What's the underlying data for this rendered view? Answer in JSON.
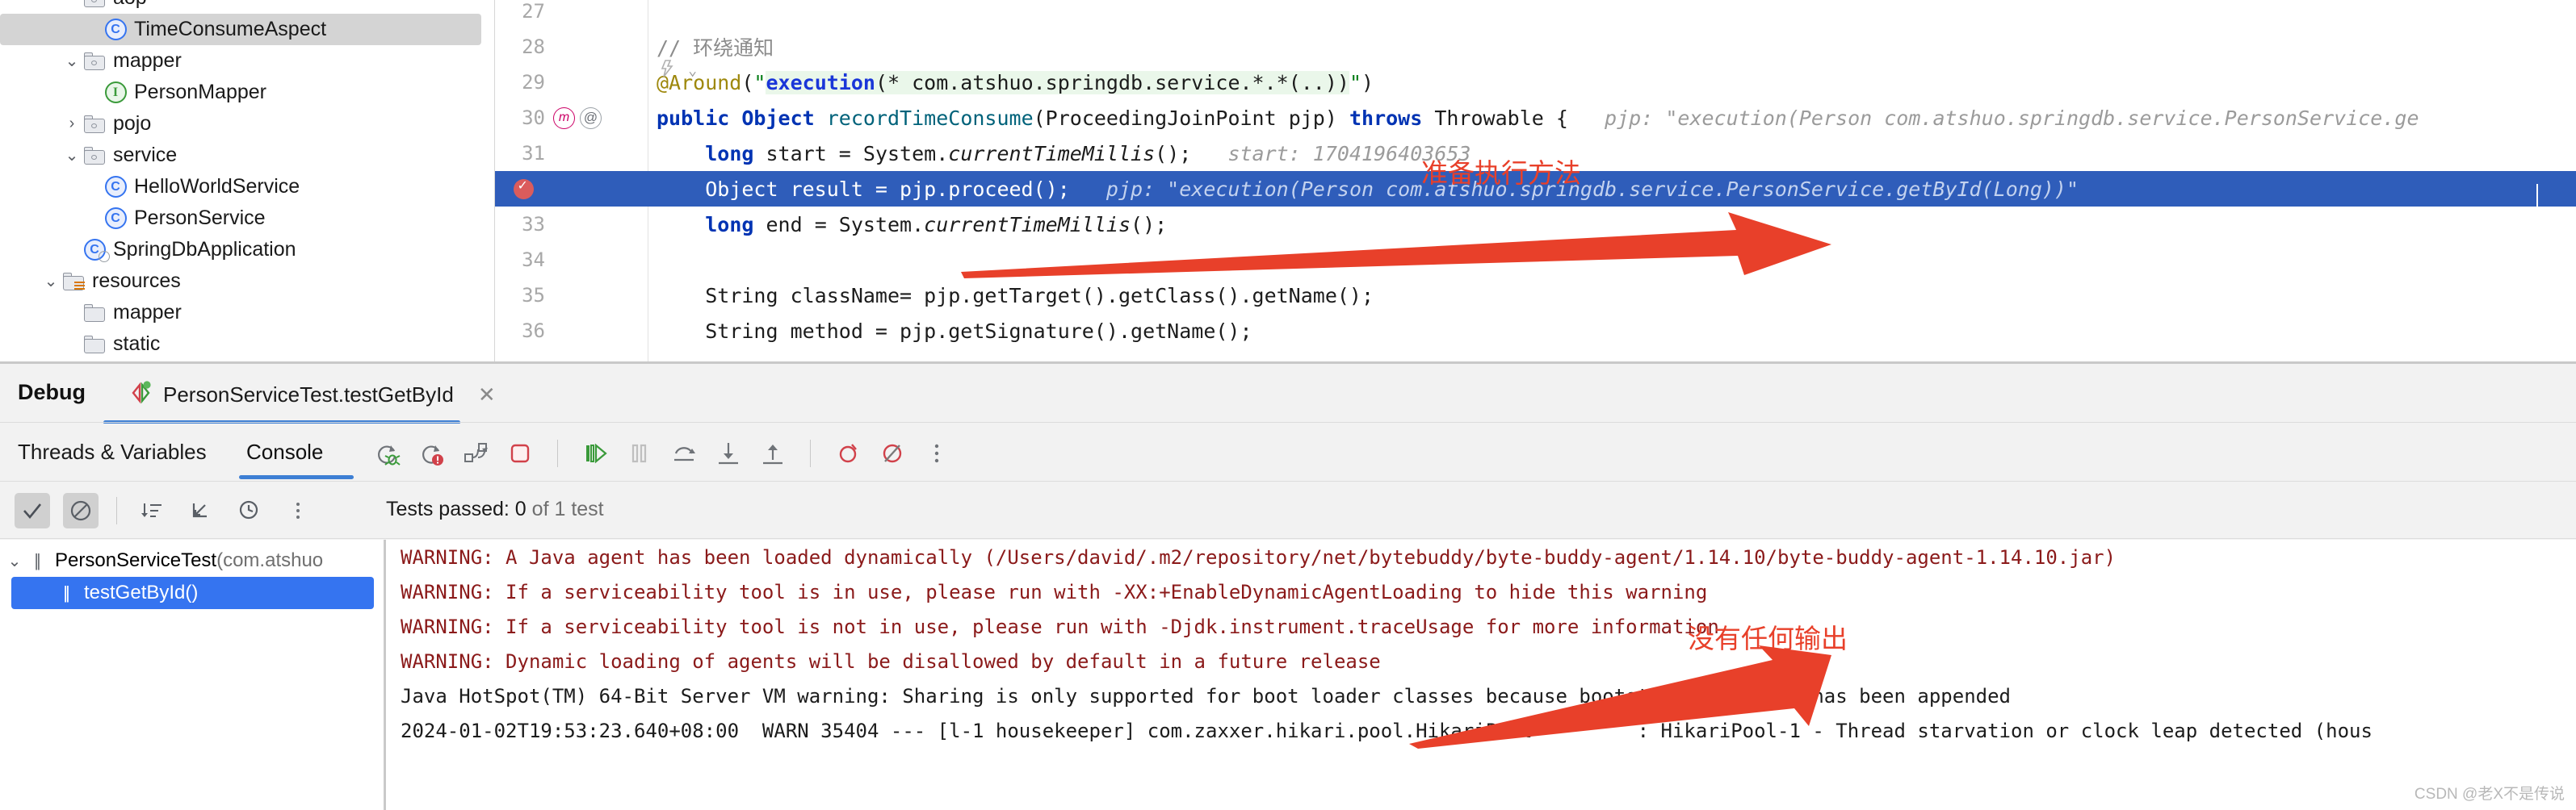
{
  "project_tree": [
    {
      "indent": 3,
      "twisty": "",
      "icon": "folder",
      "label": "aop",
      "selected": false,
      "partial": true
    },
    {
      "indent": 4,
      "twisty": "",
      "icon": "class",
      "label": "TimeConsumeAspect",
      "selected": true
    },
    {
      "indent": 3,
      "twisty": "v",
      "icon": "folder",
      "label": "mapper",
      "selected": false
    },
    {
      "indent": 4,
      "twisty": "",
      "icon": "interface",
      "label": "PersonMapper",
      "selected": false
    },
    {
      "indent": 3,
      "twisty": ">",
      "icon": "folder",
      "label": "pojo",
      "selected": false
    },
    {
      "indent": 3,
      "twisty": "v",
      "icon": "folder",
      "label": "service",
      "selected": false
    },
    {
      "indent": 4,
      "twisty": "",
      "icon": "class",
      "label": "HelloWorldService",
      "selected": false
    },
    {
      "indent": 4,
      "twisty": "",
      "icon": "class",
      "label": "PersonService",
      "selected": false
    },
    {
      "indent": 3,
      "twisty": "",
      "icon": "class-runnable",
      "label": "SpringDbApplication",
      "selected": false
    },
    {
      "indent": 2,
      "twisty": "v",
      "icon": "folder-resources",
      "label": "resources",
      "selected": false
    },
    {
      "indent": 3,
      "twisty": "",
      "icon": "folder-plain",
      "label": "mapper",
      "selected": false
    },
    {
      "indent": 3,
      "twisty": "",
      "icon": "folder-plain",
      "label": "static",
      "selected": false
    }
  ],
  "editor": {
    "lines": [
      {
        "no": "27",
        "text": ""
      },
      {
        "no": "28",
        "text": "// 环绕通知"
      },
      {
        "no": "29",
        "text": "@Around(\"execution(* com.atshuo.springdb.service.*.*(..))\")"
      },
      {
        "no": "30",
        "text": "public Object recordTimeConsume(ProceedingJoinPoint pjp) throws Throwable {",
        "hint": "pjp: \"execution(Person com.atshuo.springdb.service.PersonService.ge"
      },
      {
        "no": "31",
        "text": "long start = System.currentTimeMillis();",
        "hint": "start: 1704196403653"
      },
      {
        "no": "32",
        "text": "Object result = pjp.proceed();",
        "hint": "pjp: \"execution(Person com.atshuo.springdb.service.PersonService.getById(Long))\"",
        "highlighted": true,
        "breakpoint": true
      },
      {
        "no": "33",
        "text": "long end = System.currentTimeMillis();"
      },
      {
        "no": "34",
        "text": ""
      },
      {
        "no": "35",
        "text": "String className= pjp.getTarget().getClass().getName();"
      },
      {
        "no": "36",
        "text": "String method = pjp.getSignature().getName();"
      }
    ]
  },
  "debug": {
    "title": "Debug",
    "run_tab_label": "PersonServiceTest.testGetById",
    "close_label": "✕",
    "tab_threads": "Threads & Variables",
    "tab_console": "Console",
    "toolbar_icons": [
      "rerun-debug-icon",
      "rerun-failed-icon",
      "rerun-modified-icon",
      "stop-icon",
      "resume-program-icon",
      "pause-program-icon",
      "step-over-icon",
      "step-into-icon",
      "step-out-icon",
      "mute-breakpoints-icon",
      "view-breakpoints-icon",
      "more-options-icon"
    ],
    "console_icons": [
      "show-passed-icon",
      "hide-ignored-icon",
      "sort-alphabetically-icon",
      "expand-icon",
      "sort-by-duration-icon",
      "more-icon"
    ],
    "tests_passed_label": "Tests passed: 0",
    "tests_passed_suffix": "of 1 test",
    "test_tree": [
      {
        "label": "PersonServiceTest",
        "suffix": "(com.atshuo",
        "selected": false,
        "chevron": "v"
      },
      {
        "label": "testGetById()",
        "suffix": "",
        "selected": true,
        "chevron": ""
      }
    ],
    "console_lines": [
      {
        "type": "warn",
        "text": "WARNING: A Java agent has been loaded dynamically (/Users/david/.m2/repository/net/bytebuddy/byte-buddy-agent/1.14.10/byte-buddy-agent-1.14.10.jar)"
      },
      {
        "type": "warn",
        "text": "WARNING: If a serviceability tool is in use, please run with -XX:+EnableDynamicAgentLoading to hide this warning"
      },
      {
        "type": "warn",
        "text": "WARNING: If a serviceability tool is not in use, please run with -Djdk.instrument.traceUsage for more information"
      },
      {
        "type": "warn",
        "text": "WARNING: Dynamic loading of agents will be disallowed by default in a future release"
      },
      {
        "type": "plain",
        "text": "Java HotSpot(TM) 64-Bit Server VM warning: Sharing is only supported for boot loader classes because bootstrap classpath has been appended"
      },
      {
        "type": "plain",
        "text": "2024-01-02T19:53:23.640+08:00  WARN 35404 --- [l-1 housekeeper] com.zaxxer.hikari.pool.HikariPool         : HikariPool-1 - Thread starvation or clock leap detected (hous"
      }
    ]
  },
  "annotations": {
    "prepare_method": "准备执行方法",
    "no_output": "没有任何输出",
    "color": "#e8402a"
  },
  "watermark": "CSDN @老X不是传说"
}
